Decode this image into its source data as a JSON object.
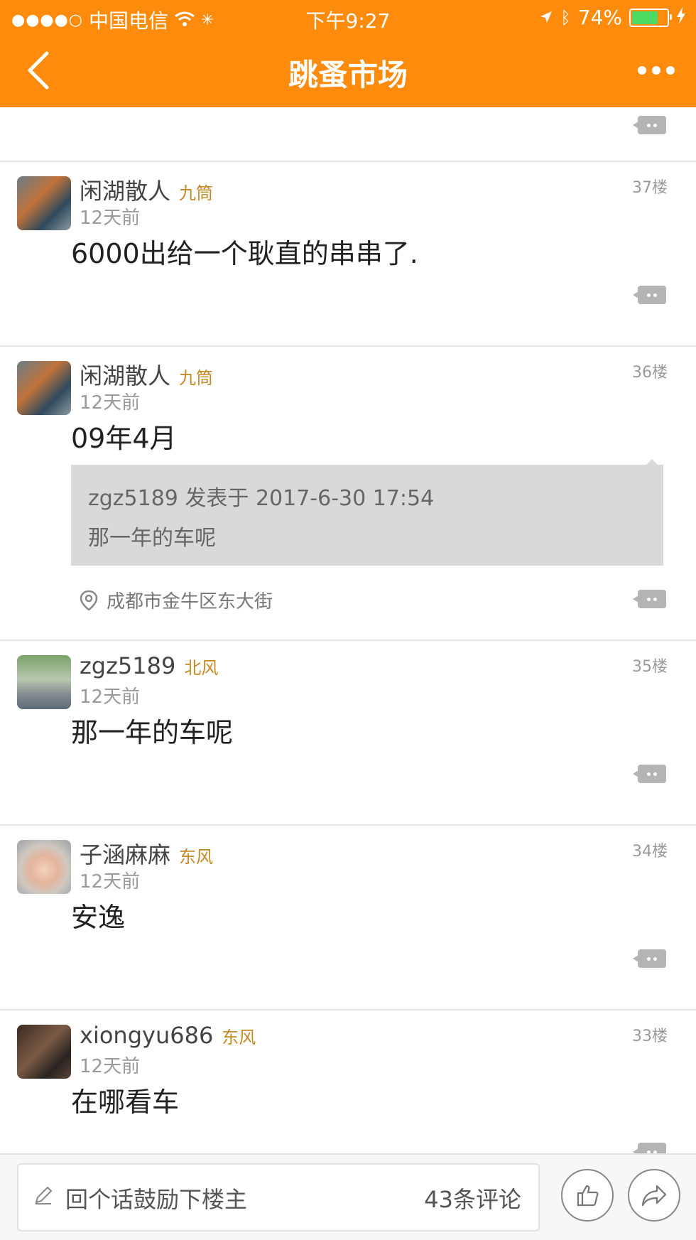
{
  "status_bar": {
    "signal": "●●●●○",
    "carrier": "中国电信",
    "time": "下午9:27",
    "battery_percent": "74%",
    "battery_level": 0.74,
    "colors": {
      "bar": "#ff8b0d",
      "battery_fill": "#4cd964"
    }
  },
  "nav": {
    "title": "跳蚤市场",
    "back_icon": "chevron-left-icon",
    "more_icon": "more-dots-icon"
  },
  "posts": [
    {
      "username": "闲湖散人",
      "level": "九筒",
      "time": "12天前",
      "floor": "37楼",
      "content": "6000出给一个耿直的串串了."
    },
    {
      "username": "闲湖散人",
      "level": "九筒",
      "time": "12天前",
      "floor": "36楼",
      "content": "09年4月",
      "quote": {
        "header": "zgz5189 发表于 2017-6-30 17:54",
        "text": "那一年的车呢"
      },
      "location": "成都市金牛区东大街"
    },
    {
      "username": "zgz5189",
      "level": "北风",
      "time": "12天前",
      "floor": "35楼",
      "content": "那一年的车呢"
    },
    {
      "username": "子涵麻麻",
      "level": "东风",
      "time": "12天前",
      "floor": "34楼",
      "content": "安逸"
    },
    {
      "username": "xiongyu686",
      "level": "东风",
      "time": "12天前",
      "floor": "33楼",
      "content": "在哪看车"
    }
  ],
  "bottom_bar": {
    "reply_placeholder": "回个话鼓励下楼主",
    "comment_count": "43条评论",
    "like_icon": "thumbs-up-icon",
    "share_icon": "share-arrow-icon"
  }
}
